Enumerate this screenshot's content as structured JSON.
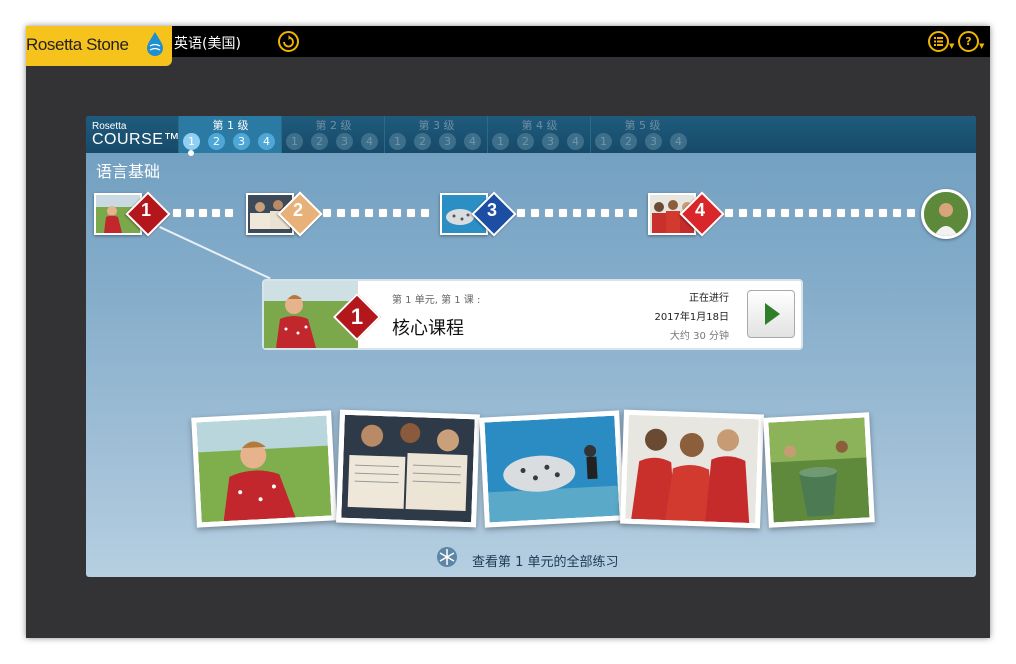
{
  "app": {
    "logo_text": "Rosetta Stone",
    "language": "英语(美国)"
  },
  "topbar": {
    "refresh_icon": "refresh-icon",
    "menu_icon": "list-menu-icon",
    "help_icon": "help-icon",
    "help_glyph": "?"
  },
  "course_logo": {
    "line1": "Rosetta",
    "line2": "COURSE™"
  },
  "levels": [
    {
      "label": "第 1 级",
      "units": [
        "1",
        "2",
        "3",
        "4"
      ],
      "active": true
    },
    {
      "label": "第 2 级",
      "units": [
        "1",
        "2",
        "3",
        "4"
      ],
      "active": false
    },
    {
      "label": "第 3 级",
      "units": [
        "1",
        "2",
        "3",
        "4"
      ],
      "active": false
    },
    {
      "label": "第 4 级",
      "units": [
        "1",
        "2",
        "3",
        "4"
      ],
      "active": false
    },
    {
      "label": "第 5 级",
      "units": [
        "1",
        "2",
        "3",
        "4"
      ],
      "active": false
    }
  ],
  "section_title": "语言基础",
  "lessons": [
    {
      "number": "1",
      "color": "#b3161b",
      "state": "current"
    },
    {
      "number": "2",
      "color": "#e8b17a",
      "state": "locked"
    },
    {
      "number": "3",
      "color": "#1c4fa3",
      "state": "locked"
    },
    {
      "number": "4",
      "color": "#d8262a",
      "state": "locked"
    }
  ],
  "card": {
    "subtitle": "第 1 单元, 第 1 课 :",
    "title": "核心课程",
    "status": "正在进行",
    "date": "2017年1月18日",
    "duration": "大约 30 分钟",
    "badge_number": "1"
  },
  "footer": {
    "link_text": "查看第 1 单元的全部练习"
  }
}
